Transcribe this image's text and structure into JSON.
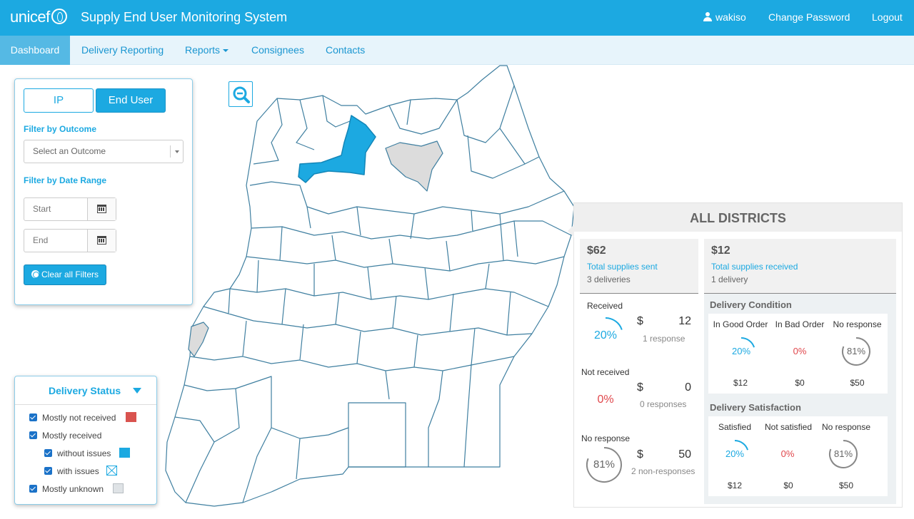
{
  "header": {
    "logo_text": "unicef",
    "app_title": "Supply End User Monitoring System",
    "username": "wakiso",
    "change_password": "Change Password",
    "logout": "Logout"
  },
  "nav": {
    "dashboard": "Dashboard",
    "delivery_reporting": "Delivery Reporting",
    "reports": "Reports",
    "consignees": "Consignees",
    "contacts": "Contacts"
  },
  "filters": {
    "tab_ip": "IP",
    "tab_end_user": "End User",
    "outcome_label": "Filter by Outcome",
    "outcome_placeholder": "Select an Outcome",
    "date_label": "Filter by Date Range",
    "start_placeholder": "Start",
    "end_placeholder": "End",
    "clear_label": "Clear all Filters"
  },
  "legend": {
    "title": "Delivery Status",
    "items": [
      {
        "label": "Mostly not received",
        "color": "#d9534f"
      },
      {
        "label": "Mostly received",
        "color": ""
      },
      {
        "label": "without issues",
        "color": "#1ca9e1"
      },
      {
        "label": "with issues",
        "color": "#1ca9e1"
      },
      {
        "label": "Mostly unknown",
        "color": "#dfe3e6"
      }
    ]
  },
  "map_colors": {
    "selected_district": "#1ca9e1",
    "unknown_district": "#dcdcdc",
    "border": "#3f7fa0"
  },
  "stats": {
    "heading": "ALL DISTRICTS",
    "sent": {
      "amount": "$62",
      "label": "Total supplies sent",
      "count": "3 deliveries"
    },
    "received": {
      "amount": "$12",
      "label": "Total supplies received",
      "count": "1 delivery"
    },
    "breakdown": [
      {
        "label": "Received",
        "percent": 20,
        "percent_text": "20%",
        "dollar": "$",
        "value": "12",
        "sub": "1 response"
      },
      {
        "label": "Not received",
        "percent": 0,
        "percent_text": "0%",
        "dollar": "$",
        "value": "0",
        "sub": "0 responses"
      },
      {
        "label": "No response",
        "percent": 81,
        "percent_text": "81%",
        "dollar": "$",
        "value": "50",
        "sub": "2 non-responses"
      }
    ],
    "condition": {
      "title": "Delivery Condition",
      "columns": [
        {
          "head": "In Good Order",
          "percent": 20,
          "percent_text": "20%",
          "amount": "$12"
        },
        {
          "head": "In Bad Order",
          "percent": 0,
          "percent_text": "0%",
          "amount": "$0"
        },
        {
          "head": "No response",
          "percent": 81,
          "percent_text": "81%",
          "amount": "$50"
        }
      ]
    },
    "satisfaction": {
      "title": "Delivery Satisfaction",
      "columns": [
        {
          "head": "Satisfied",
          "percent": 20,
          "percent_text": "20%",
          "amount": "$12"
        },
        {
          "head": "Not satisfied",
          "percent": 0,
          "percent_text": "0%",
          "amount": "$0"
        },
        {
          "head": "No response",
          "percent": 81,
          "percent_text": "81%",
          "amount": "$50"
        }
      ]
    }
  }
}
